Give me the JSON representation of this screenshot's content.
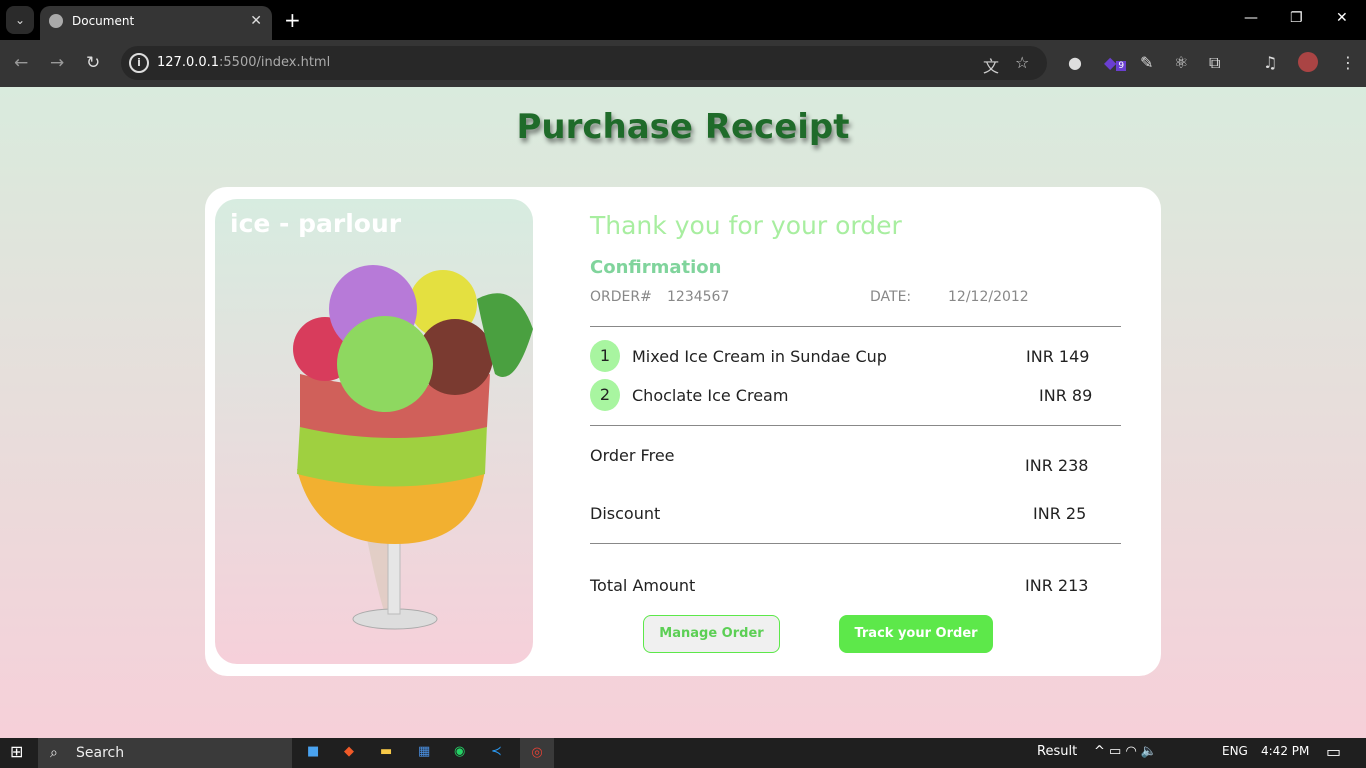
{
  "browser": {
    "tab_title": "Document",
    "url_host": "127.0.0.1",
    "url_rest": ":5500/index.html",
    "ext_badge": "9"
  },
  "page": {
    "title": "Purchase Receipt",
    "brand": "ice - parlour",
    "thanks": "Thank you for your order",
    "confirmation": "Confirmation",
    "order_label": "ORDER#",
    "order_no": "1234567",
    "date_label": "DATE:",
    "date": "12/12/2012",
    "items": [
      {
        "n": "1",
        "name": "Mixed Ice Cream in Sundae Cup",
        "price": "INR 149"
      },
      {
        "n": "2",
        "name": "Choclate Ice Cream",
        "price": "INR 89"
      }
    ],
    "order_fee_label": "Order Free",
    "order_fee": "INR 238",
    "discount_label": "Discount",
    "discount": "INR 25",
    "total_label": "Total Amount",
    "total": "INR 213",
    "manage_btn": "Manage Order",
    "track_btn": "Track your Order"
  },
  "taskbar": {
    "search": "Search",
    "weather": "Result",
    "lang": "ENG",
    "time": "4:42 PM"
  }
}
